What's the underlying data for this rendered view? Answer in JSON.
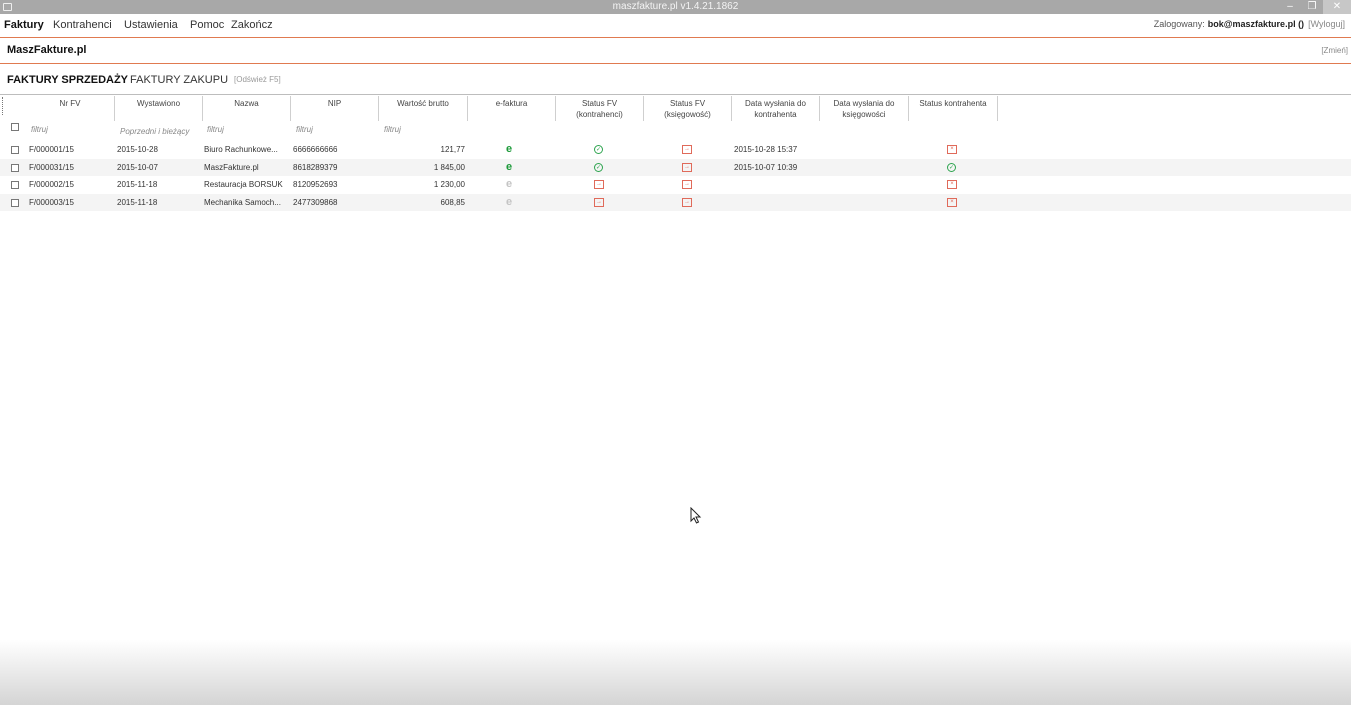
{
  "window": {
    "title": "maszfakture.pl  v1.4.21.1862",
    "minimize_glyph": "–",
    "maximize_glyph": "❐",
    "close_glyph": "✕"
  },
  "menu": {
    "items": [
      "Faktury",
      "Kontrahenci",
      "Ustawienia",
      "Pomoc",
      "Zakończ"
    ],
    "logged_label": "Zalogowany:",
    "user": "bok@maszfakture.pl ()",
    "logout": "[Wyloguj]"
  },
  "company": {
    "name": "MaszFakture.pl",
    "change": "[Zmień]"
  },
  "tabs": {
    "sales": "FAKTURY SPRZEDAŻY",
    "purchases": "FAKTURY ZAKUPU",
    "refresh": "[Odśwież F5]"
  },
  "grid": {
    "columns": [
      {
        "l1": "Nr FV",
        "l2": ""
      },
      {
        "l1": "Wystawiono",
        "l2": ""
      },
      {
        "l1": "Nazwa",
        "l2": ""
      },
      {
        "l1": "NIP",
        "l2": ""
      },
      {
        "l1": "Wartość brutto",
        "l2": ""
      },
      {
        "l1": "e-faktura",
        "l2": ""
      },
      {
        "l1": "Status FV",
        "l2": "(kontrahenci)"
      },
      {
        "l1": "Status FV",
        "l2": "(księgowość)"
      },
      {
        "l1": "Data wysłania do",
        "l2": "kontrahenta"
      },
      {
        "l1": "Data wysłania do",
        "l2": "księgowości"
      },
      {
        "l1": "Status kontrahenta",
        "l2": ""
      }
    ],
    "filters": {
      "nr": "filtruj",
      "wystawiono": "Poprzedni i bieżący",
      "nazwa": "filtruj",
      "nip": "filtruj",
      "wartosc": "filtruj"
    },
    "rows": [
      {
        "nr": "F/000001/15",
        "date": "2015-10-28",
        "name": "Biuro Rachunkowe...",
        "nip": "6666666666",
        "value": "121,77",
        "efaktura": true,
        "status_kontr": "ok",
        "status_ksieg": "send",
        "sent_kontr": "2015-10-28 15:37",
        "sent_ksieg": "",
        "status_kontrahenta": "x"
      },
      {
        "nr": "F/000031/15",
        "date": "2015-10-07",
        "name": "MaszFakture.pl",
        "nip": "8618289379",
        "value": "1 845,00",
        "efaktura": true,
        "status_kontr": "ok",
        "status_ksieg": "send",
        "sent_kontr": "2015-10-07 10:39",
        "sent_ksieg": "",
        "status_kontrahenta": "ok"
      },
      {
        "nr": "F/000002/15",
        "date": "2015-11-18",
        "name": "Restauracja BORSUK",
        "nip": "8120952693",
        "value": "1 230,00",
        "efaktura": false,
        "status_kontr": "send",
        "status_ksieg": "send",
        "sent_kontr": "",
        "sent_ksieg": "",
        "status_kontrahenta": "x"
      },
      {
        "nr": "F/000003/15",
        "date": "2015-11-18",
        "name": "Mechanika Samoch...",
        "nip": "2477309868",
        "value": "608,85",
        "efaktura": false,
        "status_kontr": "send",
        "status_ksieg": "send",
        "sent_kontr": "",
        "sent_ksieg": "",
        "status_kontrahenta": "x"
      }
    ]
  },
  "colors": {
    "accent_line": "#e07a50",
    "efaktura_on": "#1d9a3a",
    "efaktura_off": "#c4c4c4",
    "status_ok": "#2ea44f",
    "status_send": "#e06a5a"
  }
}
